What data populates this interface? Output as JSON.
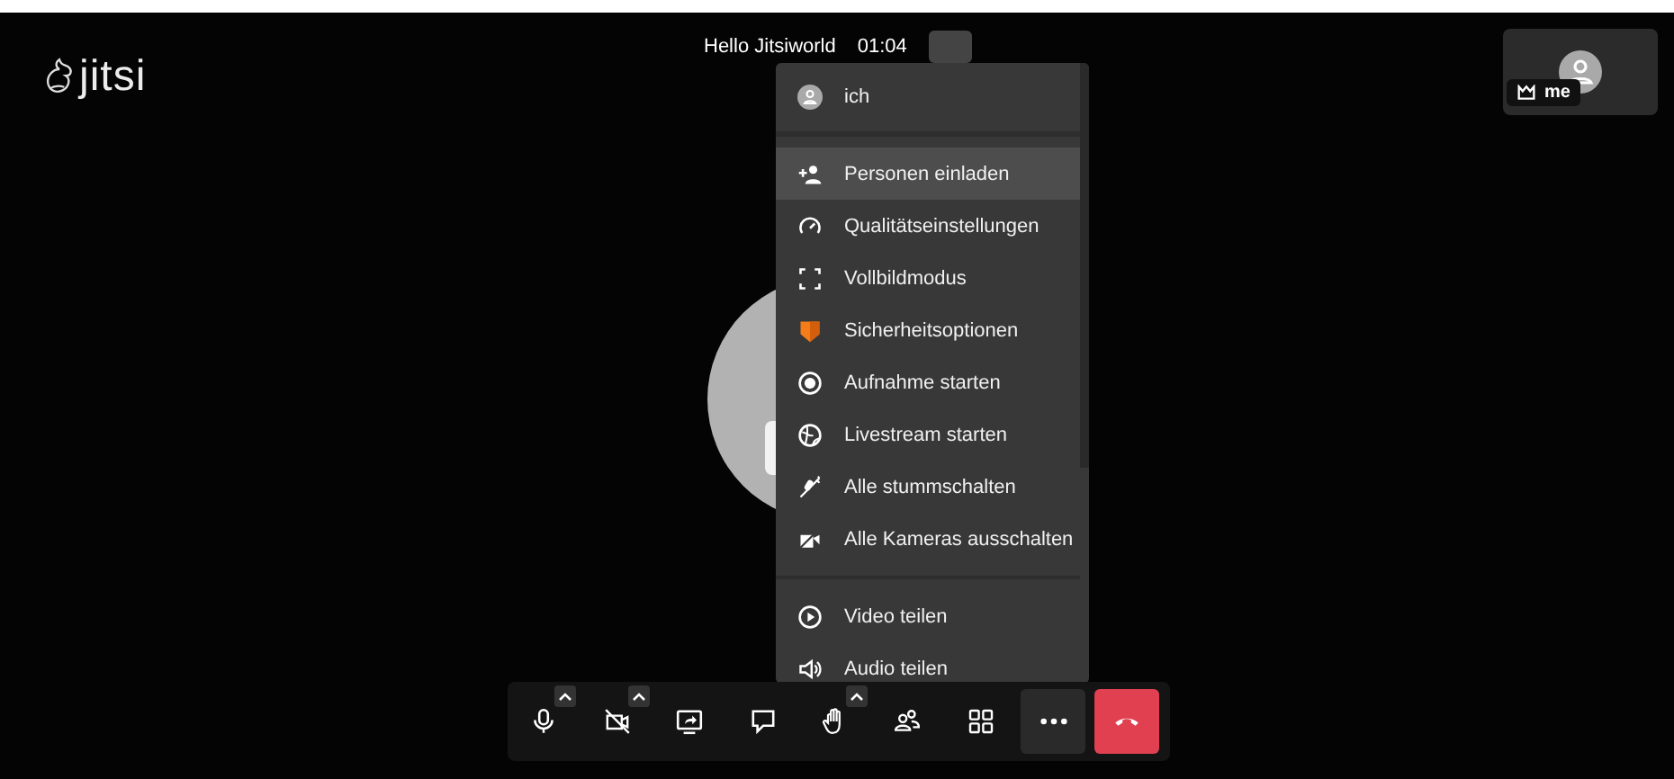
{
  "logo": {
    "text": "jitsi"
  },
  "header": {
    "title": "Hello Jitsiworld",
    "timer": "01:04"
  },
  "thumbnail": {
    "name": "me"
  },
  "menu": {
    "profile": {
      "name": "ich"
    },
    "groups": [
      [
        {
          "label": "Personen einladen",
          "highlighted": true
        },
        {
          "label": "Qualitätseinstellungen",
          "highlighted": false
        },
        {
          "label": "Vollbildmodus",
          "highlighted": false
        },
        {
          "label": "Sicherheitsoptionen",
          "highlighted": false
        },
        {
          "label": "Aufnahme starten",
          "highlighted": false
        },
        {
          "label": "Livestream starten",
          "highlighted": false
        },
        {
          "label": "Alle stummschalten",
          "highlighted": false
        },
        {
          "label": "Alle Kameras ausschalten",
          "highlighted": false
        }
      ],
      [
        {
          "label": "Video teilen",
          "highlighted": false
        },
        {
          "label": "Audio teilen",
          "highlighted": false
        }
      ]
    ]
  },
  "toolbar": [
    {
      "kind": "normal",
      "caret": true,
      "selected": false
    },
    {
      "kind": "normal",
      "caret": true,
      "selected": false
    },
    {
      "kind": "normal",
      "caret": false,
      "selected": false
    },
    {
      "kind": "normal",
      "caret": false,
      "selected": false
    },
    {
      "kind": "normal",
      "caret": true,
      "selected": false
    },
    {
      "kind": "normal",
      "caret": false,
      "selected": false
    },
    {
      "kind": "normal",
      "caret": false,
      "selected": false
    },
    {
      "kind": "normal",
      "caret": false,
      "selected": true
    },
    {
      "kind": "hangup",
      "caret": false,
      "selected": false
    }
  ]
}
